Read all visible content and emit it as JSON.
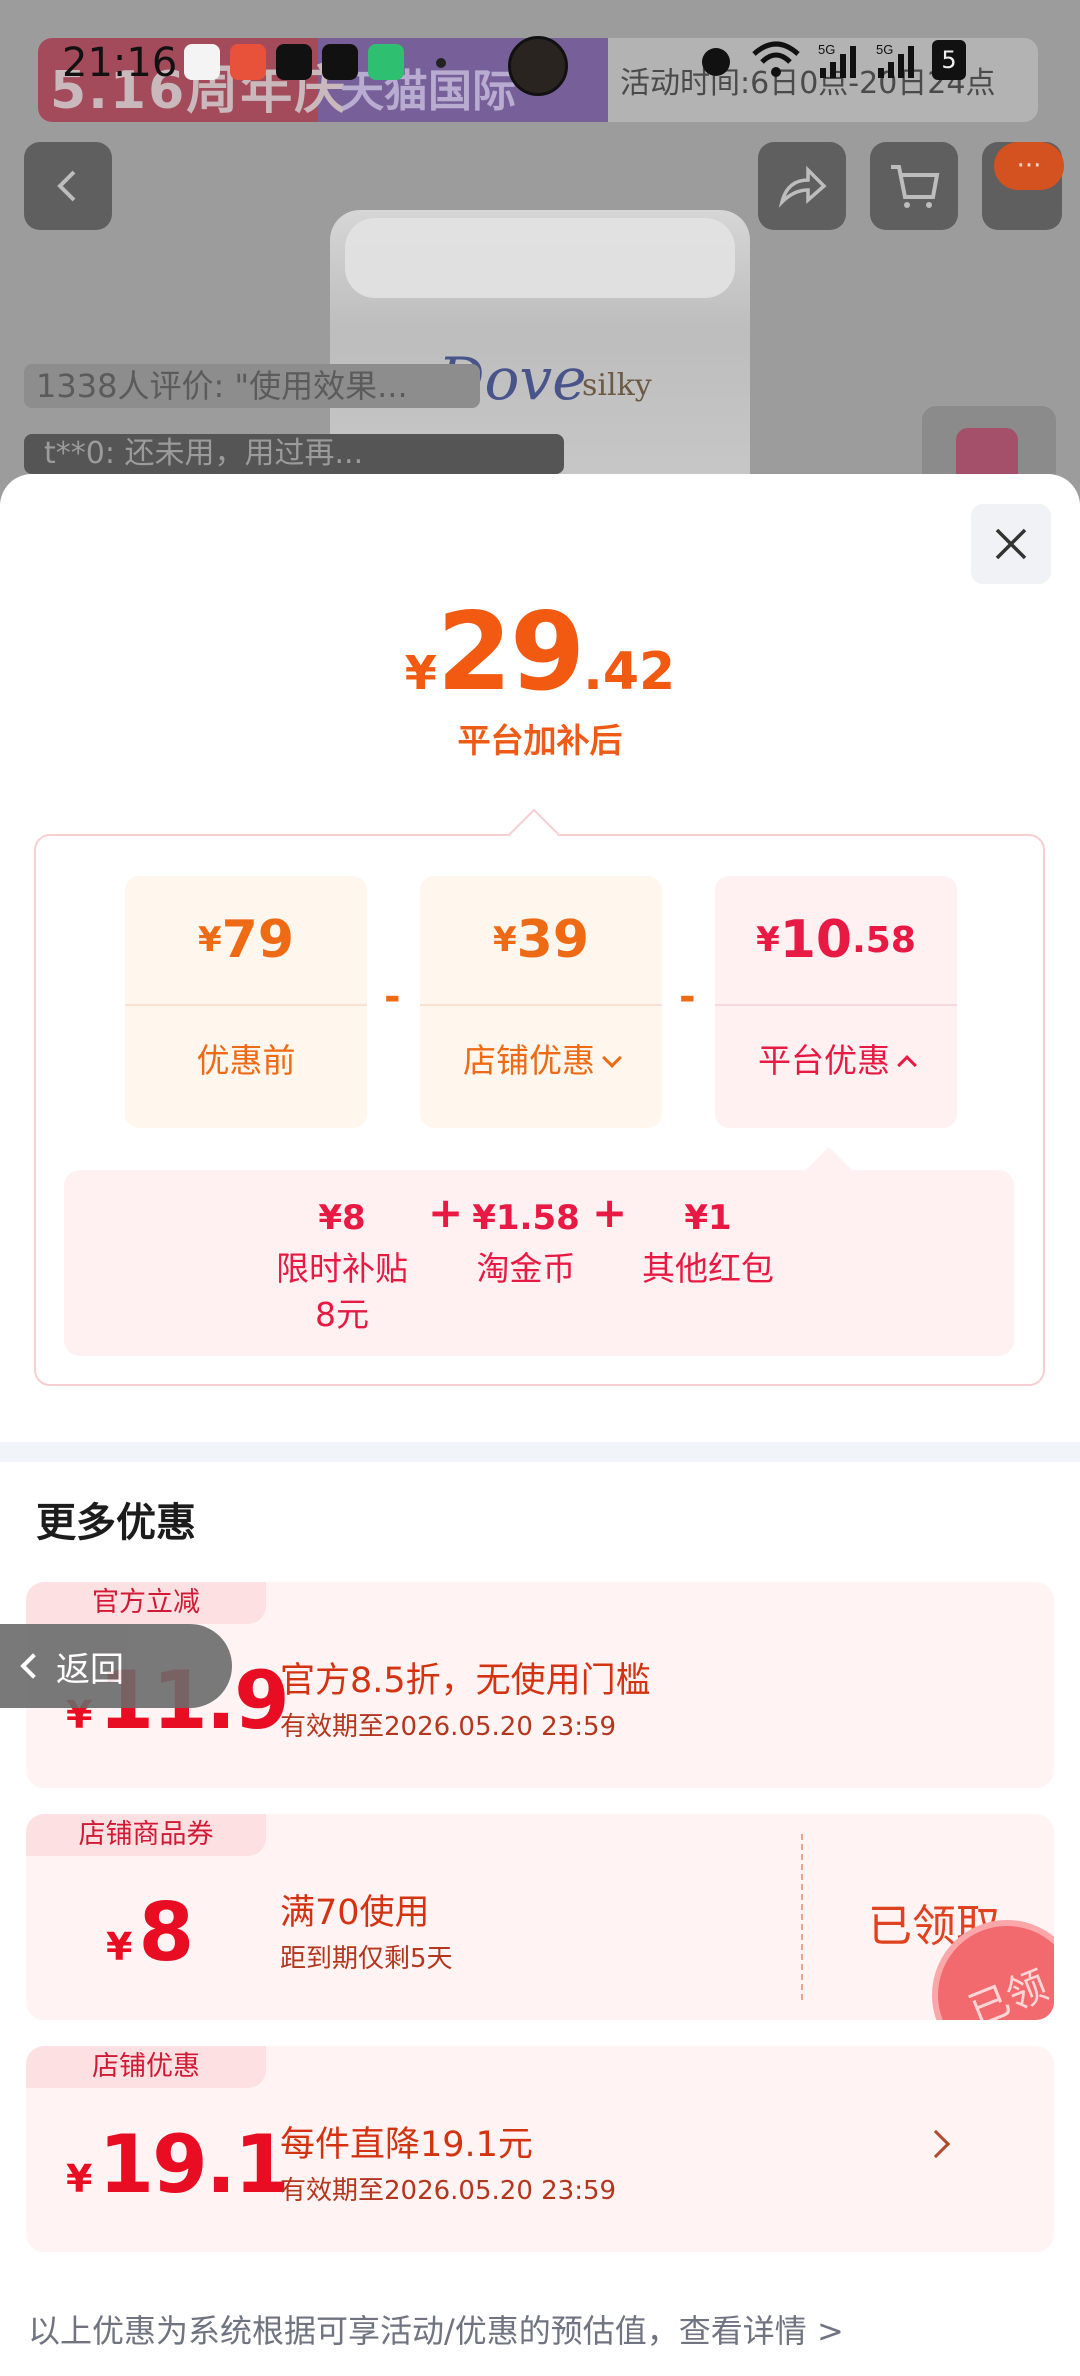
{
  "status_bar": {
    "time": "21:16",
    "battery": "5"
  },
  "background_page": {
    "banner_left": "5.16周年庆",
    "banner_mid": "天猫国际",
    "banner_right": "活动时间:6日0点-20日24点",
    "product_brand": "Dove",
    "product_variant": "silky",
    "review_text": "1338人评价: \"使用效果...",
    "user_text": "t**0: 还未用，用过再...",
    "cart_badge": "···"
  },
  "sheet": {
    "final_price": {
      "currency": "¥",
      "integer": "29",
      "decimal": ".42"
    },
    "final_caption": "平台加补后",
    "breakdown": {
      "original": {
        "currency": "¥",
        "integer": "79",
        "decimal": "",
        "label": "优惠前"
      },
      "shop_discount": {
        "currency": "¥",
        "integer": "39",
        "decimal": "",
        "label": "店铺优惠"
      },
      "platform_discount": {
        "currency": "¥",
        "integer": "10",
        "decimal": ".58",
        "label": "平台优惠"
      },
      "minus_sign": "-"
    },
    "platform_items": [
      {
        "value": "¥8",
        "label": "限时补贴\n8元"
      },
      {
        "value": "¥1.58",
        "label": "淘金币"
      },
      {
        "value": "¥1",
        "label": "其他红包"
      }
    ],
    "plus_sign": "+",
    "more_title": "更多优惠",
    "coupons": [
      {
        "tag": "官方立减",
        "currency": "¥",
        "amount": "11.9",
        "title": "官方8.5折，无使用门槛",
        "subtitle": "有效期至2026.05.20 23:59"
      },
      {
        "tag": "店铺商品券",
        "currency": "¥",
        "amount": "8",
        "title": "满70使用",
        "subtitle": "距到期仅剩5天",
        "action": "已领取",
        "stamp": "已领"
      },
      {
        "tag": "店铺优惠",
        "currency": "¥",
        "amount": "19.1",
        "title": "每件直降19.1元",
        "subtitle": "有效期至2026.05.20 23:59"
      }
    ],
    "back_label": "返回",
    "footer_note": "以上优惠为系统根据可享活动/优惠的预估值，查看详情 >"
  },
  "colors": {
    "accent_orange": "#f25a12",
    "accent_red": "#e81a44",
    "coupon_red": "#e80d22"
  }
}
